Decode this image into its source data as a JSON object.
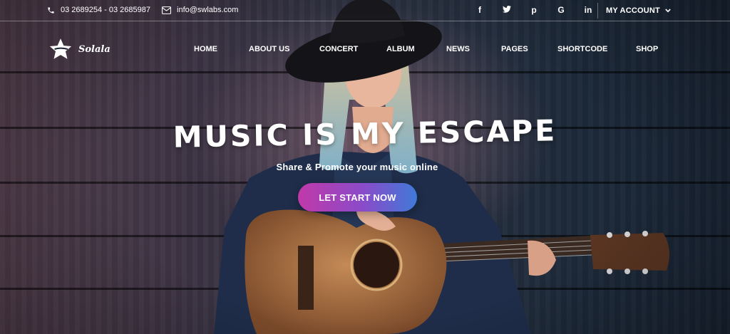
{
  "topbar": {
    "phone": "03 2689254 - 03 2685987",
    "email": "info@swlabs.com",
    "social": [
      {
        "icon": "facebook-icon",
        "glyph": "f"
      },
      {
        "icon": "twitter-icon",
        "glyph": "🐦"
      },
      {
        "icon": "pinterest-icon",
        "glyph": "p"
      },
      {
        "icon": "google-icon",
        "glyph": "G"
      },
      {
        "icon": "linkedin-icon",
        "glyph": "in"
      }
    ],
    "account_label": "MY ACCOUNT"
  },
  "brand": {
    "name": "Solala"
  },
  "nav": {
    "items": [
      "HOME",
      "ABOUT US",
      "CONCERT",
      "ALBUM",
      "NEWS",
      "PAGES",
      "SHORTCODE",
      "SHOP"
    ]
  },
  "hero": {
    "headline": "MUSIC IS MY ESCAPE",
    "subtitle": "Share & Promote your music online",
    "cta_label": "LET START NOW"
  },
  "colors": {
    "cta_gradient_start": "#c039a9",
    "cta_gradient_end": "#3f7ad9"
  }
}
